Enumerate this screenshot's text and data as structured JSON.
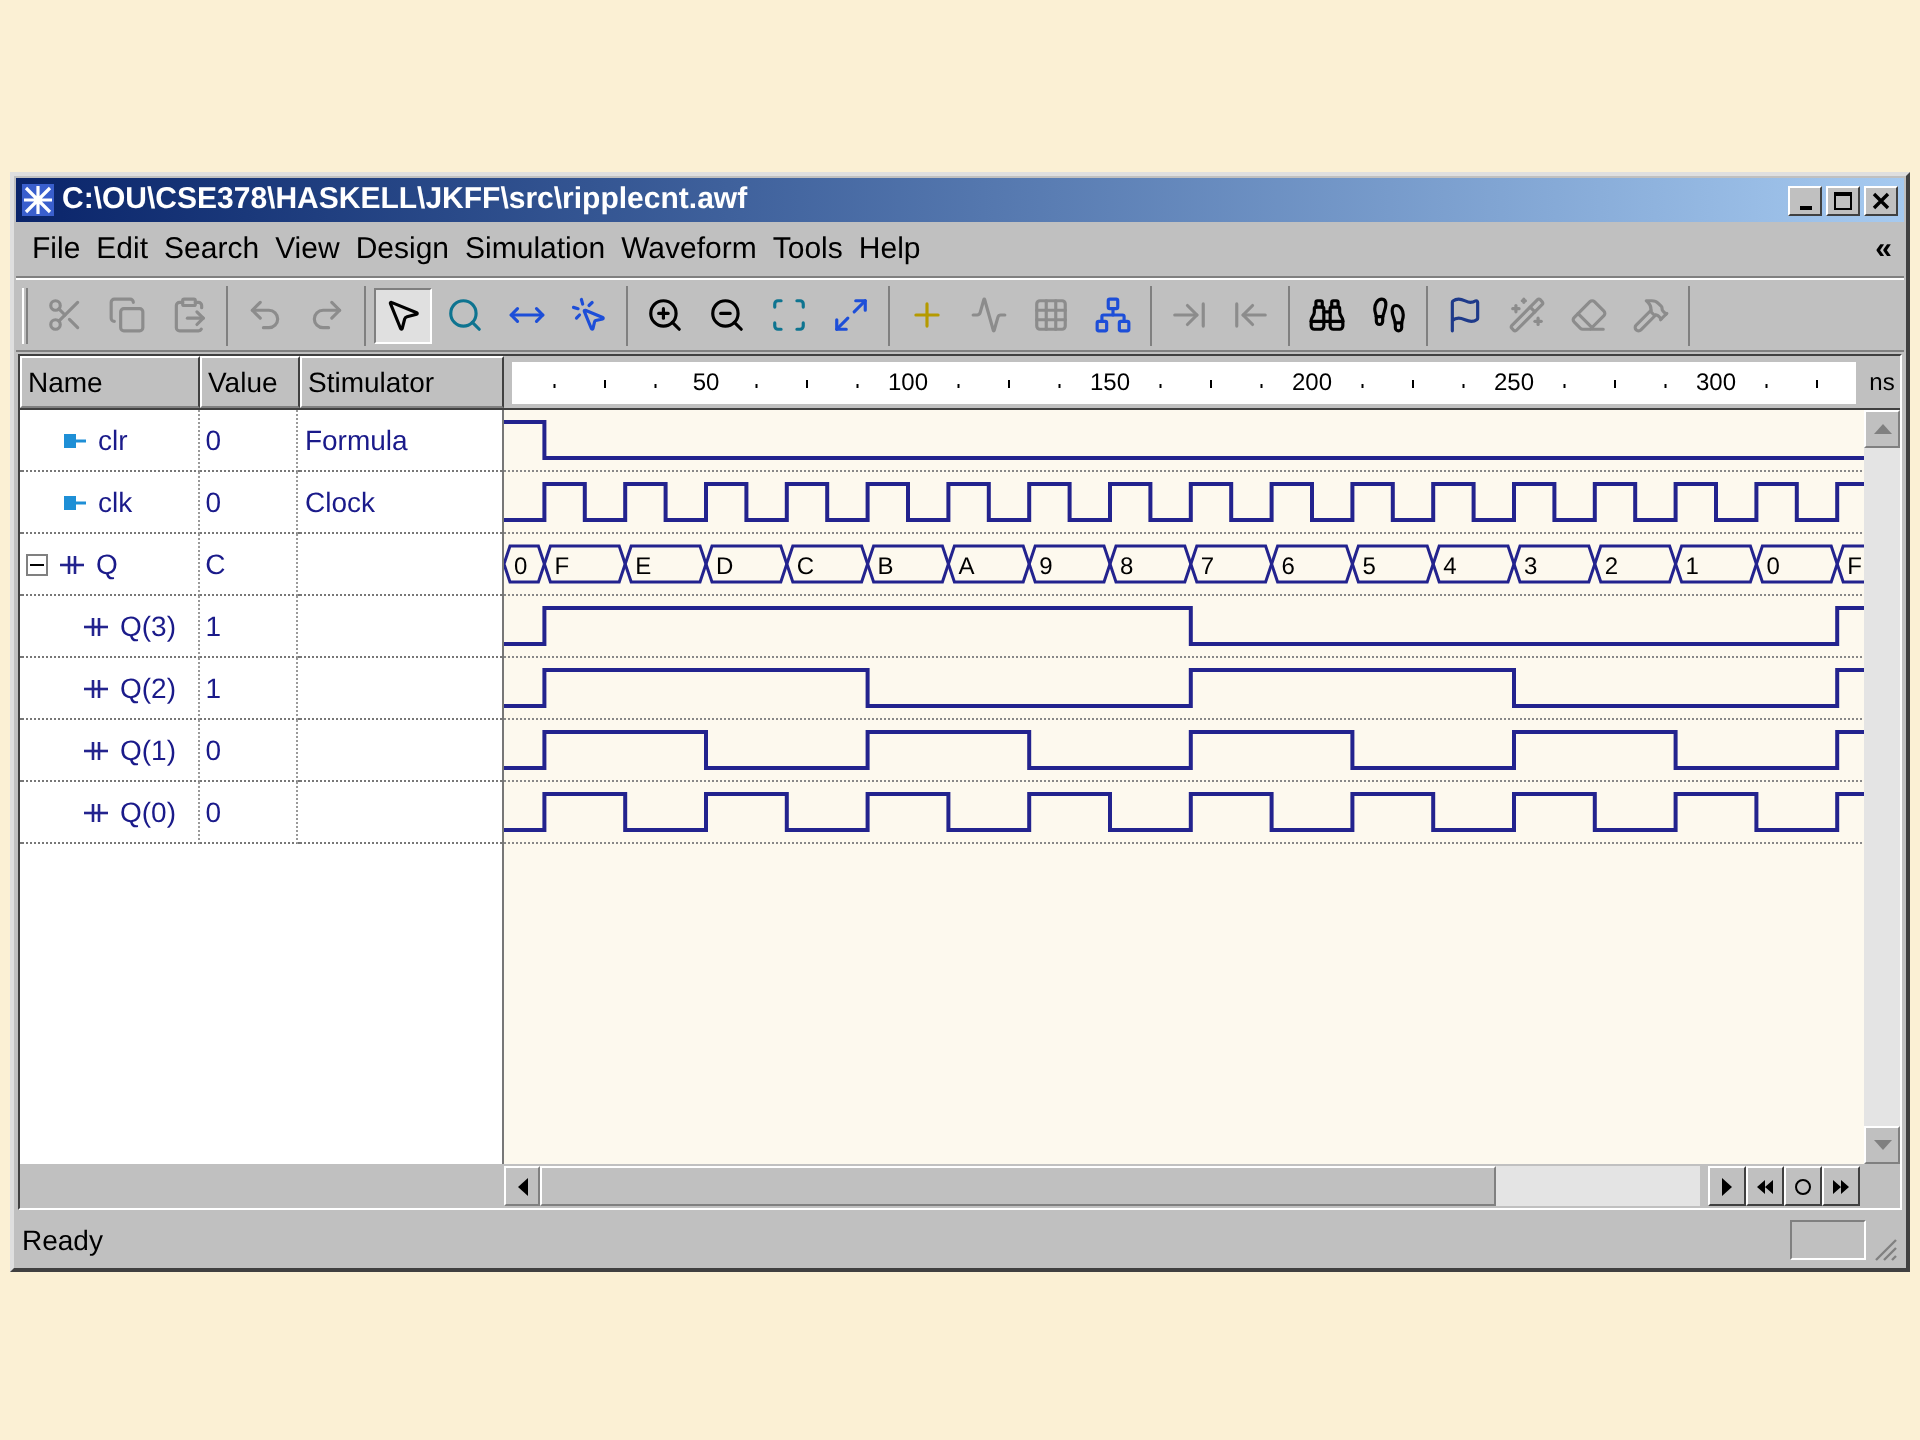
{
  "window": {
    "title": "C:\\OU\\CSE378\\HASKELL\\JKFF\\src\\ripplecnt.awf"
  },
  "menu": [
    "File",
    "Edit",
    "Search",
    "View",
    "Design",
    "Simulation",
    "Waveform",
    "Tools",
    "Help"
  ],
  "menu_chevron": "«",
  "toolbar": [
    [
      {
        "disabled": true,
        "pressed": false
      },
      {
        "disabled": true,
        "pressed": false
      },
      {
        "disabled": true,
        "pressed": false
      }
    ],
    [
      {
        "disabled": true,
        "pressed": false
      },
      {
        "disabled": true,
        "pressed": false
      }
    ],
    [
      {
        "disabled": false,
        "pressed": true
      },
      {
        "disabled": false,
        "pressed": false
      },
      {
        "disabled": false,
        "pressed": false
      },
      {
        "disabled": false,
        "pressed": false
      }
    ],
    [
      {
        "disabled": false,
        "pressed": false
      },
      {
        "disabled": false,
        "pressed": false
      },
      {
        "disabled": false,
        "pressed": false
      },
      {
        "disabled": false,
        "pressed": false
      }
    ],
    [
      {
        "disabled": false,
        "pressed": false
      },
      {
        "disabled": true,
        "pressed": false
      },
      {
        "disabled": true,
        "pressed": false
      },
      {
        "disabled": false,
        "pressed": false
      }
    ],
    [
      {
        "disabled": true,
        "pressed": false
      },
      {
        "disabled": true,
        "pressed": false
      }
    ],
    [
      {
        "disabled": false,
        "pressed": false
      },
      {
        "disabled": false,
        "pressed": false
      }
    ],
    [
      {
        "disabled": false,
        "pressed": false
      },
      {
        "disabled": true,
        "pressed": false
      },
      {
        "disabled": true,
        "pressed": false
      },
      {
        "disabled": true,
        "pressed": false
      }
    ]
  ],
  "columns": [
    "Name",
    "Value",
    "Stimulator"
  ],
  "signals": [
    {
      "kind": "formula",
      "name": "clr",
      "value": "0",
      "stimulator": "Formula"
    },
    {
      "kind": "clock",
      "name": "clk",
      "value": "0",
      "stimulator": "Clock"
    },
    {
      "kind": "bus",
      "name": "Q",
      "value": "C",
      "expanded": true,
      "segments": [
        "0",
        "F",
        "E",
        "D",
        "C",
        "B",
        "A",
        "9",
        "8",
        "7",
        "6",
        "5",
        "4",
        "3",
        "2",
        "1",
        "0",
        "F"
      ],
      "children": [
        {
          "kind": "bit",
          "name": "Q(3)",
          "value": "1"
        },
        {
          "kind": "bit",
          "name": "Q(2)",
          "value": "1"
        },
        {
          "kind": "bit",
          "name": "Q(1)",
          "value": "0"
        },
        {
          "kind": "bit",
          "name": "Q(0)",
          "value": "0"
        }
      ]
    }
  ],
  "ruler": {
    "labels": [
      "50",
      "100",
      "150",
      "200",
      "250",
      "300"
    ],
    "unit": "ns"
  },
  "status_bar": {
    "text": "Ready"
  }
}
